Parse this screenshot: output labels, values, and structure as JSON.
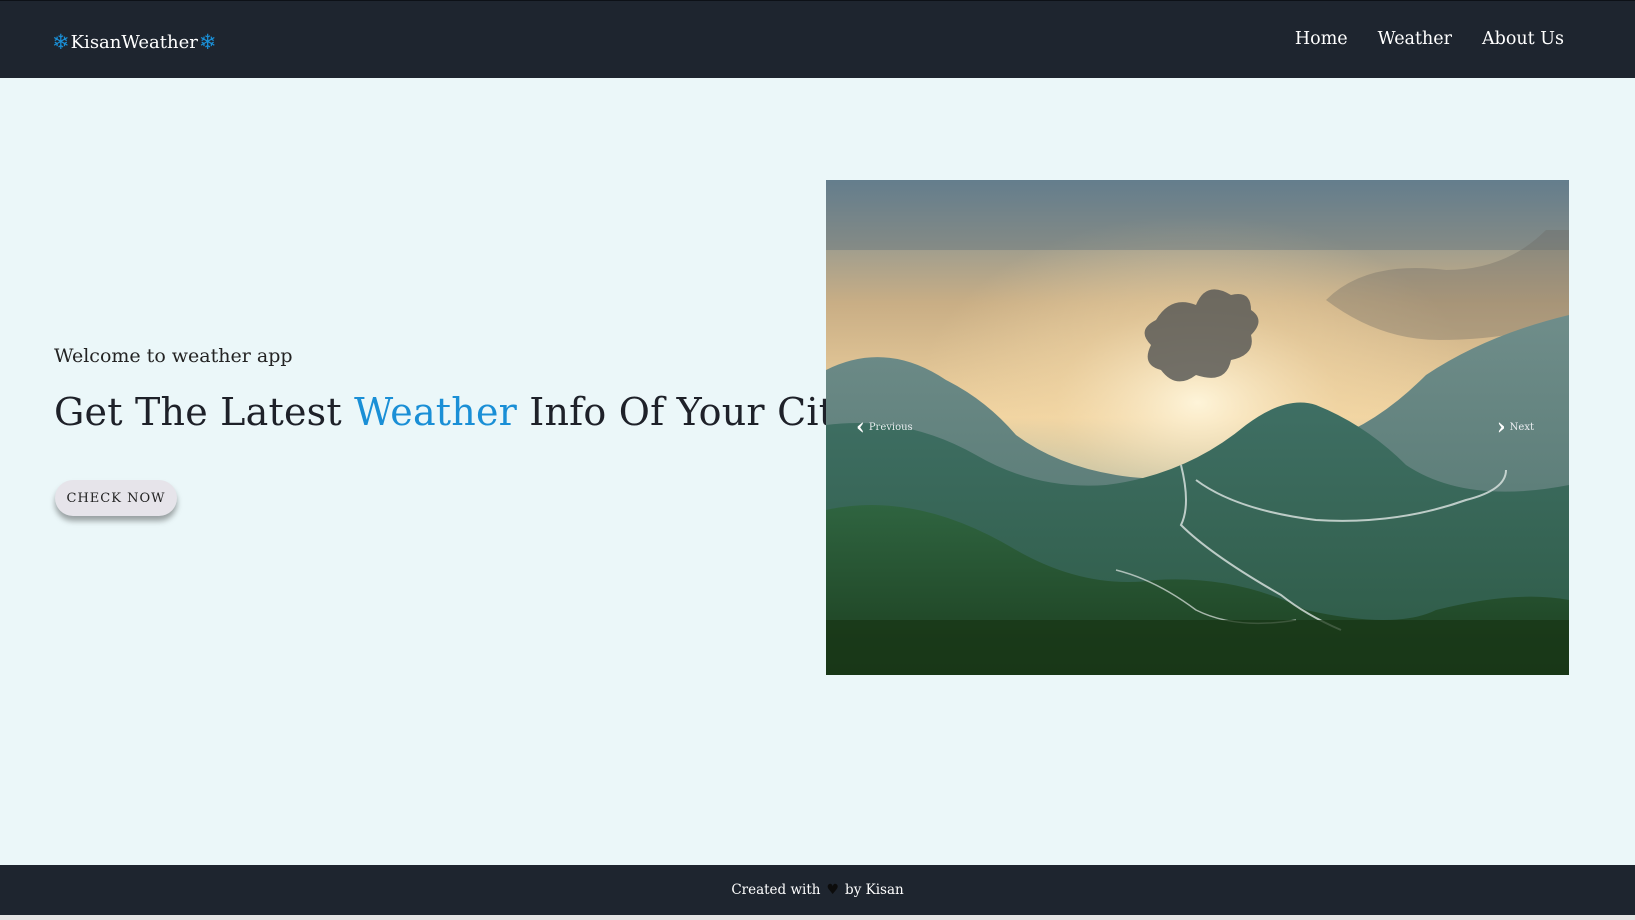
{
  "brand": {
    "name": "KisanWeather",
    "icon": "snowflake-icon",
    "accent": "#1a8fd6"
  },
  "nav": {
    "items": [
      "Home",
      "Weather",
      "About Us"
    ]
  },
  "hero": {
    "welcome": "Welcome to weather app",
    "headline_before": "Get The Latest",
    "headline_accent": "Weather",
    "headline_after": "Info Of Your City",
    "button": "CHECK NOW"
  },
  "carousel": {
    "prev_label": "Previous",
    "next_label": "Next",
    "image": "mountain-valley-sunrise-image"
  },
  "footer": {
    "before": "Created with",
    "heart": "heart-icon",
    "after": "by Kisan"
  },
  "colors": {
    "navbar": "#1e252f",
    "background": "#ebf7f9",
    "accent": "#1a8fd6"
  }
}
